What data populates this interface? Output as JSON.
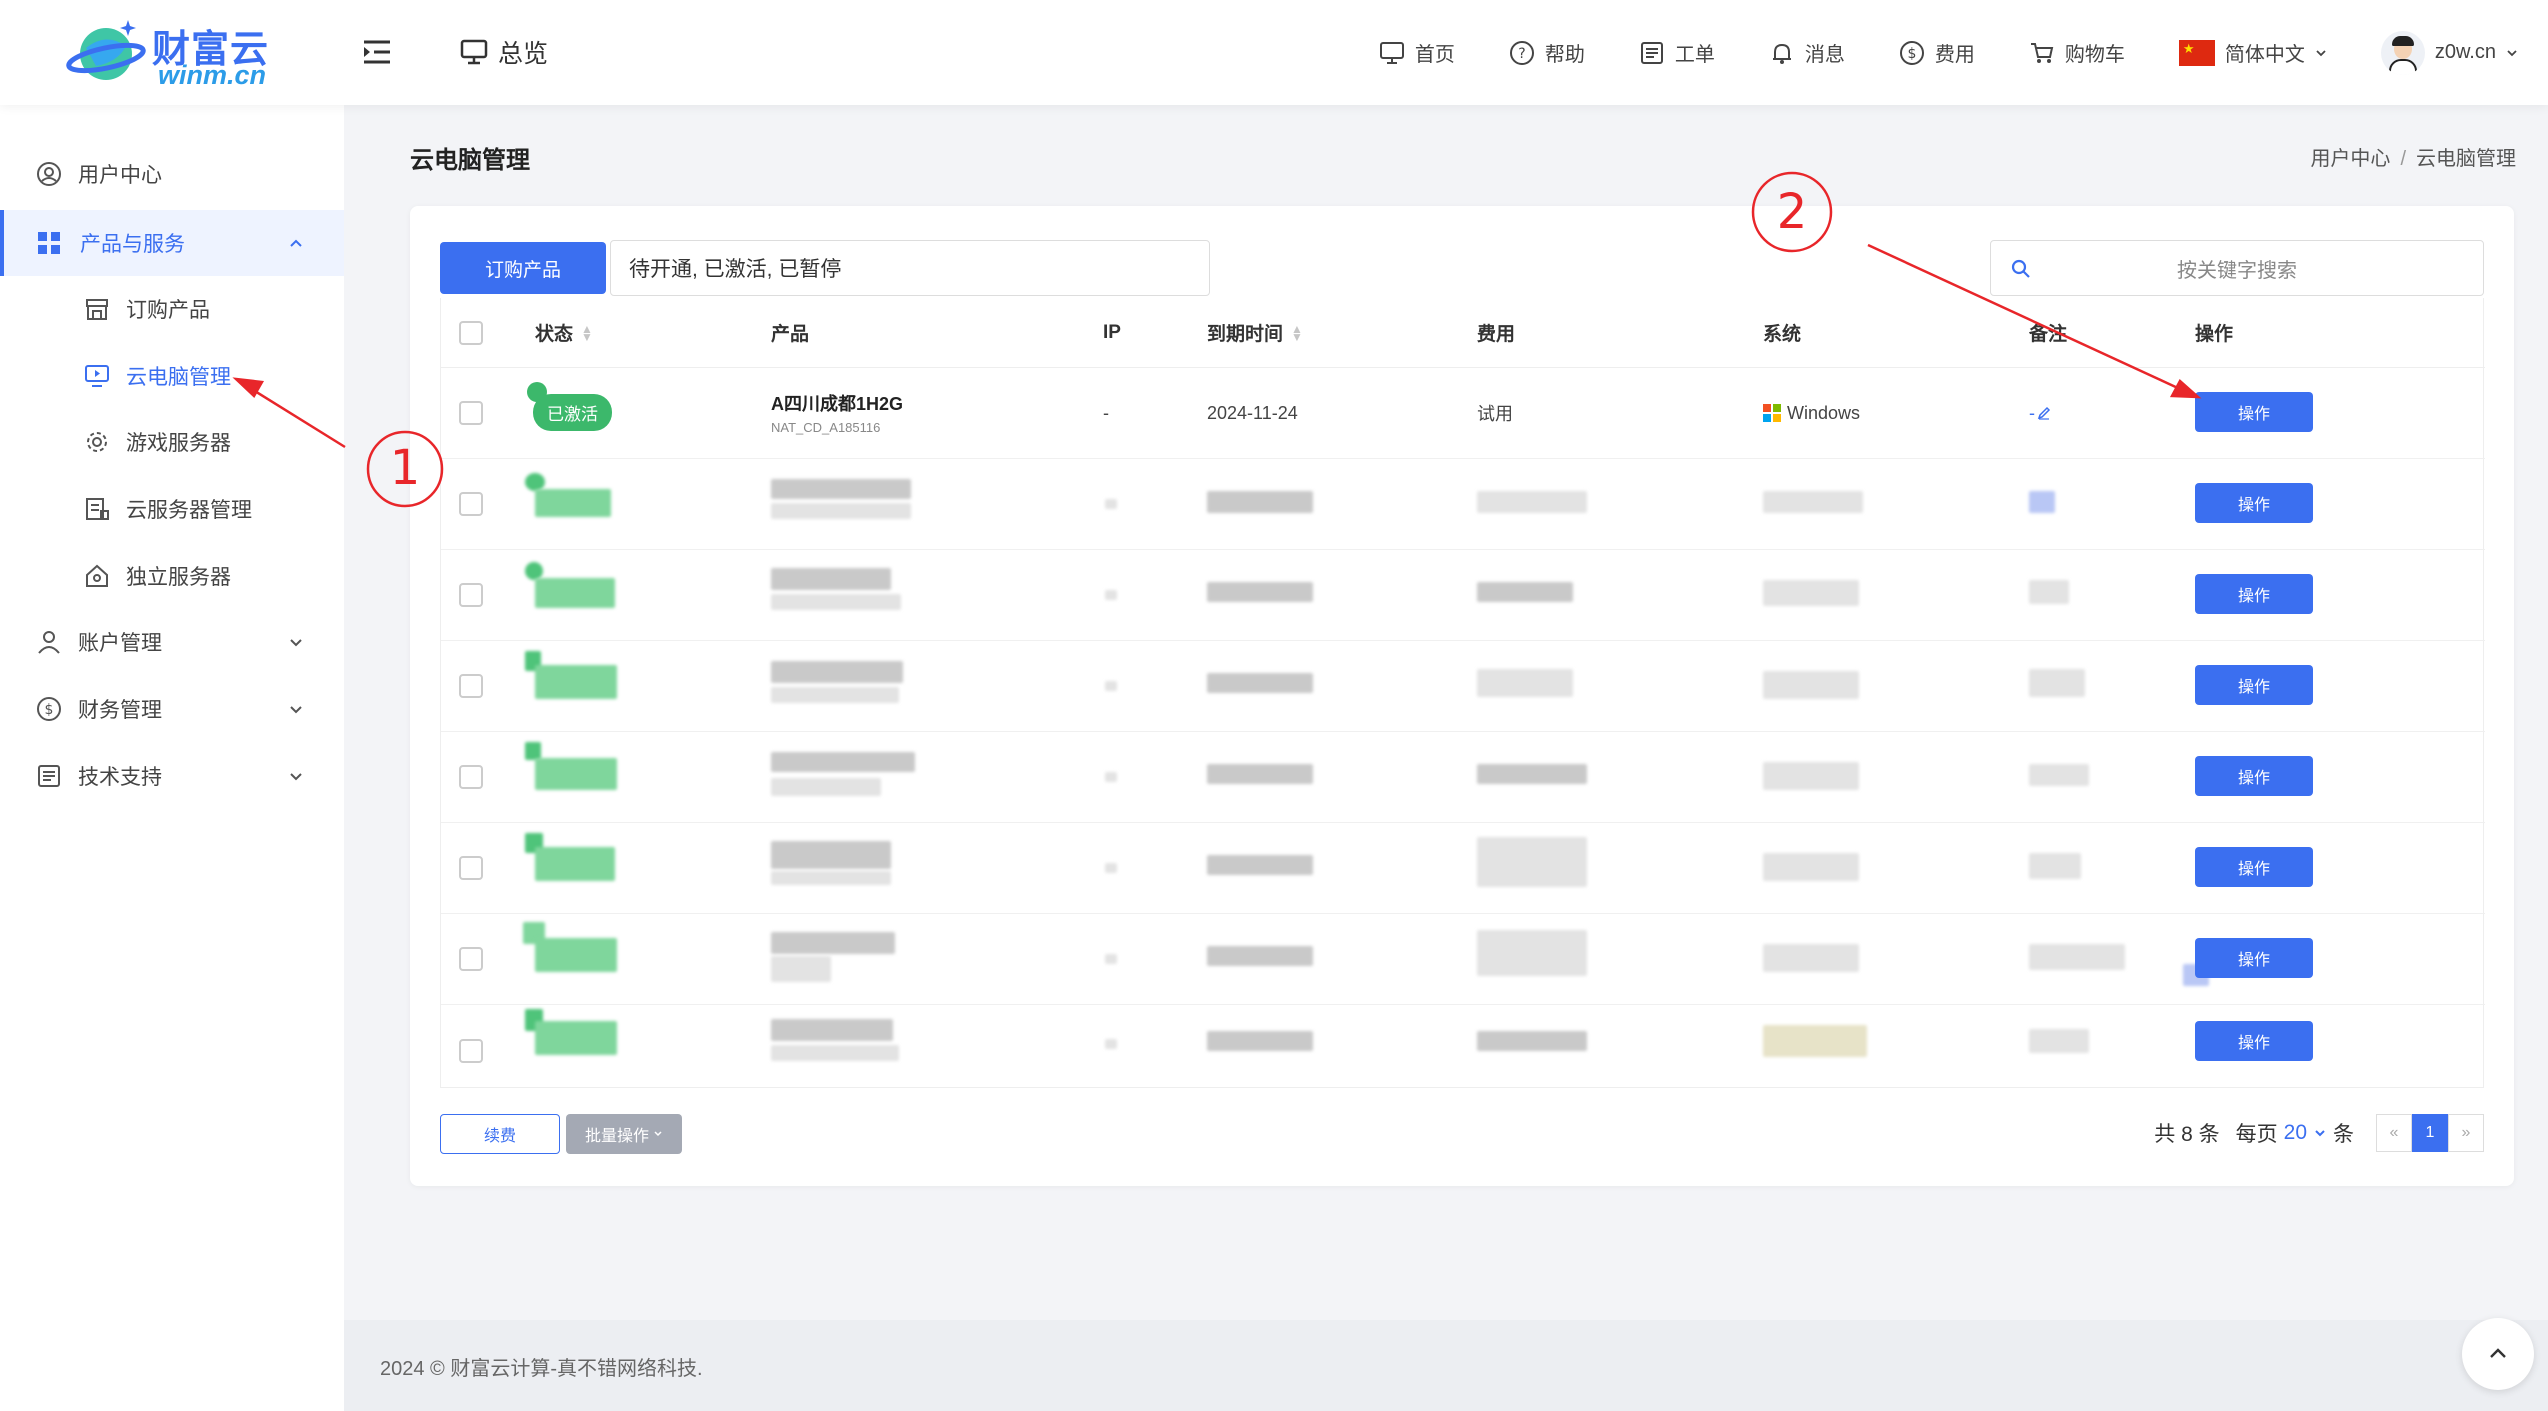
{
  "header": {
    "logo_title": "财富云",
    "logo_domain": "winm.cn",
    "overview": "总览",
    "nav": [
      {
        "label": "首页",
        "icon": "monitor-icon"
      },
      {
        "label": "帮助",
        "icon": "help-icon"
      },
      {
        "label": "工单",
        "icon": "ticket-icon"
      },
      {
        "label": "消息",
        "icon": "bell-icon"
      },
      {
        "label": "费用",
        "icon": "dollar-icon"
      },
      {
        "label": "购物车",
        "icon": "cart-icon"
      }
    ],
    "language": "简体中文",
    "username": "z0w.cn"
  },
  "sidebar": {
    "items": [
      {
        "label": "用户中心"
      },
      {
        "label": "产品与服务"
      },
      {
        "label": "订购产品"
      },
      {
        "label": "云电脑管理"
      },
      {
        "label": "游戏服务器"
      },
      {
        "label": "云服务器管理"
      },
      {
        "label": "独立服务器"
      },
      {
        "label": "账户管理"
      },
      {
        "label": "财务管理"
      },
      {
        "label": "技术支持"
      }
    ]
  },
  "page": {
    "title": "云电脑管理",
    "breadcrumb": [
      "用户中心",
      "云电脑管理"
    ]
  },
  "toolbar": {
    "order_button": "订购产品",
    "filter_value": "待开通, 已激活, 已暂停",
    "search_placeholder": "按关键字搜索"
  },
  "table": {
    "columns": [
      "状态",
      "产品",
      "IP",
      "到期时间",
      "费用",
      "系统",
      "备注",
      "操作"
    ],
    "rows": [
      {
        "status": "已激活",
        "product": "A四川成都1H2G",
        "code": "NAT_CD_A185116",
        "ip": "-",
        "expiry": "2024-11-24",
        "fee": "试用",
        "system": "Windows",
        "note": "-",
        "action": "操作"
      },
      {
        "action": "操作"
      },
      {
        "action": "操作"
      },
      {
        "action": "操作"
      },
      {
        "action": "操作"
      },
      {
        "action": "操作"
      },
      {
        "action": "操作"
      },
      {
        "action": "操作"
      }
    ]
  },
  "footer_actions": {
    "renew": "续费",
    "batch": "批量操作"
  },
  "pagination": {
    "total": "共 8 条",
    "per_page_label": "每页",
    "per_page": "20",
    "unit": "条",
    "prev": "«",
    "current": "1",
    "next": "»"
  },
  "annotations": {
    "step1": "1",
    "step2": "2"
  },
  "site_footer": "2024 © 财富云计算-真不错网络科技.",
  "colors": {
    "accent": "#3b6ff0",
    "status_active": "#3cb86b",
    "annotation": "#e8262a"
  }
}
